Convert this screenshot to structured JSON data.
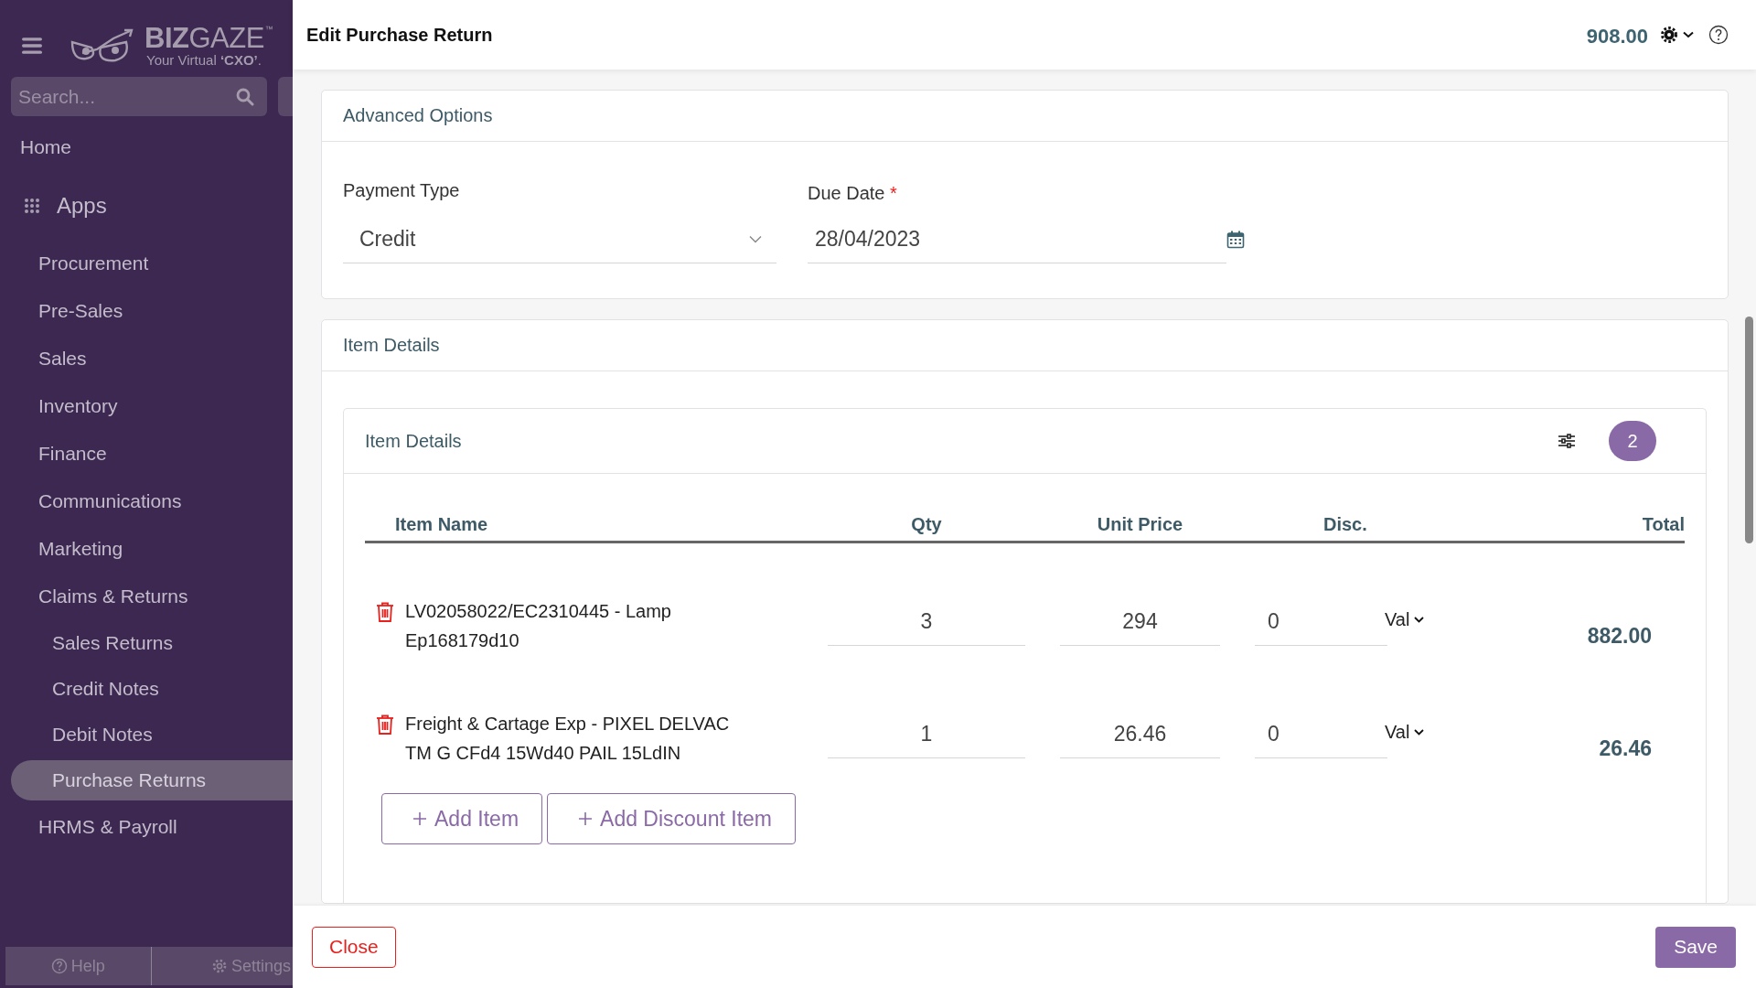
{
  "sidebar": {
    "logo": {
      "brand": "**BIZ**GAZE",
      "trademark": "™",
      "tagline": "Your Virtual **‘CXO’**."
    },
    "search": {
      "placeholder": "Search..."
    },
    "home": "Home",
    "apps": "Apps",
    "items": [
      {
        "label": "Procurement",
        "selected": false
      },
      {
        "label": "Pre-Sales",
        "selected": false
      },
      {
        "label": "Sales",
        "selected": false
      },
      {
        "label": "Inventory",
        "selected": false
      },
      {
        "label": "Finance",
        "selected": false
      },
      {
        "label": "Communications",
        "selected": false
      },
      {
        "label": "Marketing",
        "selected": false
      },
      {
        "label": "Claims & Returns",
        "selected": false,
        "children": [
          {
            "label": "Sales Returns",
            "selected": false
          },
          {
            "label": "Credit Notes",
            "selected": false
          },
          {
            "label": "Debit Notes",
            "selected": false
          },
          {
            "label": "Purchase Returns",
            "selected": true
          }
        ]
      },
      {
        "label": "HRMS & Payroll",
        "selected": false
      }
    ],
    "footer": [
      {
        "label": "Help",
        "kind": "help"
      },
      {
        "label": "Settings",
        "kind": "settings"
      }
    ]
  },
  "header": {
    "title": "Edit Purchase Return",
    "total": "908.00"
  },
  "advanced_options": {
    "title": "Advanced Options",
    "payment_type": {
      "label": "Payment Type",
      "value": "Credit"
    },
    "due_date": {
      "label": "Due Date",
      "required_mark": "*",
      "value": "28/04/2023"
    }
  },
  "item_details": {
    "title": "Item Details",
    "inner_title": "Item Details",
    "count": "2",
    "columns": [
      "Item Name",
      "Qty",
      "Unit Price",
      "Disc.",
      "Total"
    ],
    "rows": [
      {
        "name": "LV02058022/EC2310445 - Lamp Ep168179d10",
        "qty": "3",
        "unit_price": "294",
        "discount": "0",
        "discount_type": "Val",
        "total": "882.00"
      },
      {
        "name": "Freight & Cartage Exp - PIXEL DELVAC TM G CFd4 15Wd40 PAIL 15LdIN",
        "qty": "1",
        "unit_price": "26.46",
        "discount": "0",
        "discount_type": "Val",
        "total": "26.46"
      }
    ],
    "buttons": [
      "Add Item",
      "Add Discount Item"
    ]
  },
  "footer": {
    "close": "Close",
    "save": "Save"
  }
}
